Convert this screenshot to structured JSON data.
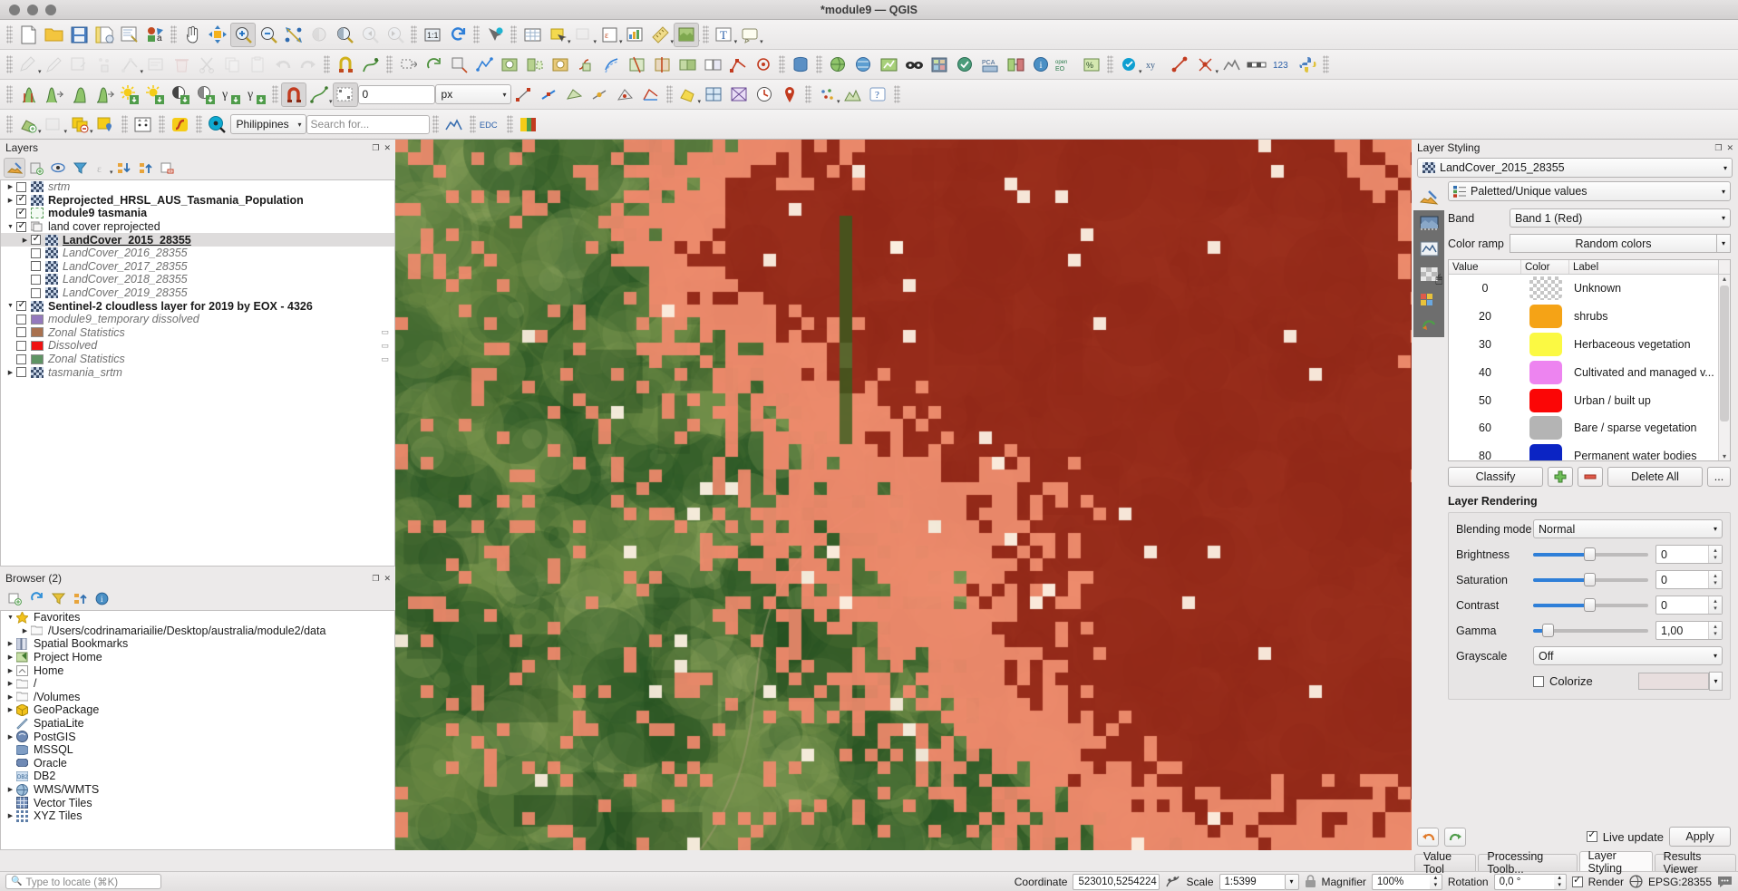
{
  "window": {
    "title": "*module9 — QGIS"
  },
  "toolbars": {
    "row3": {
      "value_field": "0",
      "unit": "px"
    },
    "row4": {
      "region_combo": "Philippines",
      "search_placeholder": "Search for..."
    }
  },
  "layers_panel": {
    "title": "Layers",
    "items": [
      {
        "label": "srtm",
        "checked": false,
        "expandable": true,
        "indent": 0,
        "style": "italic",
        "icon": "raster-icon"
      },
      {
        "label": "Reprojected_HRSL_AUS_Tasmania_Population",
        "checked": true,
        "expandable": true,
        "indent": 0,
        "style": "bold",
        "icon": "raster-icon"
      },
      {
        "label": "module9 tasmania",
        "checked": true,
        "expandable": false,
        "indent": 0,
        "style": "bold",
        "icon": "polygon-outline-icon"
      },
      {
        "label": "land cover reprojected",
        "checked": true,
        "expandable": true,
        "expanded": true,
        "indent": 0,
        "style": "normal",
        "icon": "group-icon"
      },
      {
        "label": "LandCover_2015_28355",
        "checked": true,
        "expandable": true,
        "indent": 1,
        "style": "bold-underline",
        "icon": "raster-icon",
        "selected": true
      },
      {
        "label": "LandCover_2016_28355",
        "checked": false,
        "expandable": false,
        "indent": 1,
        "style": "italic",
        "icon": "raster-icon"
      },
      {
        "label": "LandCover_2017_28355",
        "checked": false,
        "expandable": false,
        "indent": 1,
        "style": "italic",
        "icon": "raster-icon"
      },
      {
        "label": "LandCover_2018_28355",
        "checked": false,
        "expandable": false,
        "indent": 1,
        "style": "italic",
        "icon": "raster-icon"
      },
      {
        "label": "LandCover_2019_28355",
        "checked": false,
        "expandable": false,
        "indent": 1,
        "style": "italic",
        "icon": "raster-icon"
      },
      {
        "label": "Sentinel-2 cloudless layer for 2019 by EOX - 4326",
        "checked": true,
        "expandable": true,
        "expanded": true,
        "indent": 0,
        "style": "bold",
        "icon": "raster-icon"
      },
      {
        "label": "module9_temporary dissolved",
        "checked": false,
        "expandable": false,
        "indent": 0,
        "style": "italic",
        "icon": "swatch",
        "color": "#9479bd"
      },
      {
        "label": "Zonal Statistics",
        "checked": false,
        "expandable": false,
        "indent": 0,
        "style": "italic",
        "icon": "swatch",
        "color": "#a9714f",
        "tail": "filter-icon"
      },
      {
        "label": "Dissolved",
        "checked": false,
        "expandable": false,
        "indent": 0,
        "style": "italic",
        "icon": "swatch",
        "color": "#ef1111",
        "tail": "filter-icon"
      },
      {
        "label": "Zonal Statistics",
        "checked": false,
        "expandable": false,
        "indent": 0,
        "style": "italic",
        "icon": "swatch",
        "color": "#5e9464",
        "tail": "filter-icon"
      },
      {
        "label": "tasmania_srtm",
        "checked": false,
        "expandable": true,
        "indent": 0,
        "style": "italic",
        "icon": "raster-icon"
      }
    ]
  },
  "browser_panel": {
    "title": "Browser (2)",
    "items": [
      {
        "label": "Favorites",
        "indent": 0,
        "expandable": true,
        "expanded": true,
        "icon": "star-icon"
      },
      {
        "label": "/Users/codrinamariailie/Desktop/australia/module2/data",
        "indent": 1,
        "expandable": true,
        "icon": "folder-icon"
      },
      {
        "label": "Spatial Bookmarks",
        "indent": 0,
        "expandable": true,
        "icon": "bookmark-icon"
      },
      {
        "label": "Project Home",
        "indent": 0,
        "expandable": true,
        "icon": "project-home-icon"
      },
      {
        "label": "Home",
        "indent": 0,
        "expandable": true,
        "icon": "home-icon"
      },
      {
        "label": "/",
        "indent": 0,
        "expandable": true,
        "icon": "folder-icon"
      },
      {
        "label": "/Volumes",
        "indent": 0,
        "expandable": true,
        "icon": "folder-icon"
      },
      {
        "label": "GeoPackage",
        "indent": 0,
        "expandable": true,
        "icon": "geopackage-icon"
      },
      {
        "label": "SpatiaLite",
        "indent": 0,
        "expandable": false,
        "icon": "spatialite-icon"
      },
      {
        "label": "PostGIS",
        "indent": 0,
        "expandable": true,
        "icon": "postgis-icon"
      },
      {
        "label": "MSSQL",
        "indent": 0,
        "expandable": false,
        "icon": "mssql-icon"
      },
      {
        "label": "Oracle",
        "indent": 0,
        "expandable": false,
        "icon": "oracle-icon"
      },
      {
        "label": "DB2",
        "indent": 0,
        "expandable": false,
        "icon": "db2-icon"
      },
      {
        "label": "WMS/WMTS",
        "indent": 0,
        "expandable": true,
        "icon": "globe-icon"
      },
      {
        "label": "Vector Tiles",
        "indent": 0,
        "expandable": false,
        "icon": "grid-icon"
      },
      {
        "label": "XYZ Tiles",
        "indent": 0,
        "expandable": true,
        "icon": "dots-grid-icon"
      }
    ]
  },
  "layer_styling": {
    "title": "Layer Styling",
    "layer_name": "LandCover_2015_28355",
    "renderer": "Paletted/Unique values",
    "band_label": "Band",
    "band_value": "Band 1 (Red)",
    "color_ramp_label": "Color ramp",
    "color_ramp_value": "Random colors",
    "table": {
      "headers": [
        "Value",
        "Color",
        "Label"
      ],
      "rows": [
        {
          "value": "0",
          "color": "checker",
          "label": "Unknown"
        },
        {
          "value": "20",
          "color": "#f5a316",
          "label": "shrubs"
        },
        {
          "value": "30",
          "color": "#fbf943",
          "label": "Herbaceous vegetation"
        },
        {
          "value": "40",
          "color": "#ed84f0",
          "label": "Cultivated and managed v..."
        },
        {
          "value": "50",
          "color": "#fb0606",
          "label": "Urban / built up"
        },
        {
          "value": "60",
          "color": "#b4b4b4",
          "label": "Bare / sparse vegetation"
        },
        {
          "value": "80",
          "color": "#0b24c4",
          "label": "Permanent water bodies"
        }
      ]
    },
    "buttons": {
      "classify": "Classify",
      "add": "add-class-icon",
      "remove": "remove-class-icon",
      "delete_all": "Delete All",
      "more": "..."
    },
    "rendering": {
      "heading": "Layer Rendering",
      "blending_label": "Blending mode",
      "blending_value": "Normal",
      "brightness_label": "Brightness",
      "brightness_value": "0",
      "saturation_label": "Saturation",
      "saturation_value": "0",
      "contrast_label": "Contrast",
      "contrast_value": "0",
      "gamma_label": "Gamma",
      "gamma_value": "1,00",
      "grayscale_label": "Grayscale",
      "grayscale_value": "Off",
      "colorize_label": "Colorize",
      "colorize_checked": false
    },
    "live_update_label": "Live update",
    "live_update_checked": true,
    "apply_label": "Apply"
  },
  "dock_tabs": [
    {
      "label": "Value Tool",
      "active": false
    },
    {
      "label": "Processing Toolb...",
      "active": false
    },
    {
      "label": "Layer Styling",
      "active": true
    },
    {
      "label": "Results Viewer",
      "active": false
    }
  ],
  "statusbar": {
    "locator_placeholder": "Type to locate (⌘K)",
    "coordinate_label": "Coordinate",
    "coordinate_value": "523010,5254224",
    "scale_label": "Scale",
    "scale_value": "1:5399",
    "magnifier_label": "Magnifier",
    "magnifier_value": "100%",
    "rotation_label": "Rotation",
    "rotation_value": "0,0 °",
    "render_label": "Render",
    "render_checked": true,
    "crs_value": "EPSG:28355"
  },
  "map": {
    "accent_colors": {
      "urban": "#f58a6e",
      "urban_dark": "#9c2216",
      "veg_dark": "#2f6d2b",
      "veg_mid": "#6f8f4c",
      "veg_light": "#9fb36d",
      "bare": "#f6e7d8"
    }
  }
}
